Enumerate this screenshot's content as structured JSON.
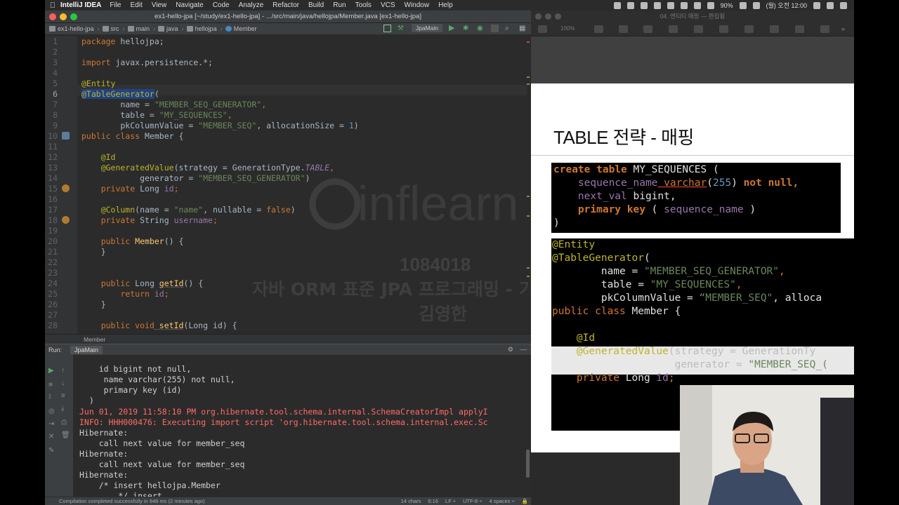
{
  "menubar": {
    "app_name": "IntelliJ IDEA",
    "items": [
      "File",
      "Edit",
      "View",
      "Navigate",
      "Code",
      "Analyze",
      "Refactor",
      "Build",
      "Run",
      "Tools",
      "VCS",
      "Window",
      "Help"
    ],
    "battery": "90%",
    "clock": "(월) 오전 12:00"
  },
  "ide": {
    "window_title": "ex1-hello-jpa [~/study/ex1-hello-jpa] - .../src/main/java/hellojpa/Member.java [ex1-hello-jpa]",
    "breadcrumbs": [
      "ex1-hello-jpa",
      "src",
      "main",
      "java",
      "hellojpa",
      "Member"
    ],
    "run_config": "JpaMain",
    "line_numbers": [
      "1",
      "2",
      "3",
      "4",
      "5",
      "6",
      "7",
      "8",
      "9",
      "10",
      "11",
      "12",
      "13",
      "14",
      "15",
      "16",
      "17",
      "18",
      "19",
      "20",
      "21",
      "22",
      "23",
      "24",
      "25",
      "26",
      "27",
      "28"
    ],
    "code_lines": {
      "l1_kw": "package",
      "l1_rest": " hellojpa;",
      "l3_kw": "import",
      "l3_rest": " javax.persistence.*;",
      "l5": "@Entity",
      "l6_an": "@TableGenerator",
      "l6_rest": "(",
      "l7_a": "        name = ",
      "l7_s": "\"MEMBER_SEQ_GENERATOR\"",
      "l7_b": ",",
      "l8_a": "        table = ",
      "l8_s": "\"MY_SEQUENCES\"",
      "l8_b": ",",
      "l9_a": "        pkColumnValue = ",
      "l9_s": "\"MEMBER_SEQ\"",
      "l9_b": ", allocationSize = ",
      "l9_n": "1",
      "l9_c": ")",
      "l10_kw": "public class",
      "l10_rest": " Member {",
      "l12": "    @Id",
      "l13_an": "    @GeneratedValue",
      "l13_a": "(strategy = GenerationType.",
      "l13_it": "TABLE",
      "l13_b": ",",
      "l14_a": "            generator = ",
      "l14_s": "\"MEMBER_SEQ_GENERATOR\"",
      "l14_b": ")",
      "l15_kw": "    private",
      "l15_a": " Long ",
      "l15_f": "id",
      "l15_b": ";",
      "l17_an": "    @Column",
      "l17_a": "(name = ",
      "l17_s": "\"name\"",
      "l17_b": ", nullable = ",
      "l17_kw": "false",
      "l17_c": ")",
      "l18_kw": "    private",
      "l18_a": " String ",
      "l18_f": "username",
      "l18_b": ";",
      "l20_kw": "    public",
      "l20_fn": " Member",
      "l20_a": "() {",
      "l21": "    }",
      "l24_kw": "    public",
      "l24_a": " Long ",
      "l24_fn": "getId",
      "l24_b": "() {",
      "l25_kw": "        return",
      "l25_f": " id",
      "l25_b": ";",
      "l26": "    }",
      "l28_kw": "    public void",
      "l28_fn": " setId",
      "l28_a": "(Long id) {"
    },
    "file_tab": "Member",
    "watermark": {
      "brand": "inflearn",
      "id": "1084018",
      "course": "자바 ORM 표준 JPA 프로그래밍 - 기본편",
      "owner": "김영한"
    },
    "run_panel": {
      "label": "Run:",
      "tab": "JpaMain",
      "console_lines": [
        "    id bigint not null,",
        "     name varchar(255) not null,",
        "     primary key (id)",
        "  )",
        "Jun 01, 2019 11:58:10 PM org.hibernate.tool.schema.internal.SchemaCreatorImpl applyI",
        "INFO: HHH000476: Executing import script 'org.hibernate.tool.schema.internal.exec.Sc",
        "Hibernate:",
        "    call next value for member_seq",
        "Hibernate:",
        "    call next value for member_seq",
        "Hibernate:",
        "    /* insert hellojpa.Member",
        "        */ insert"
      ]
    },
    "status": {
      "message": "Compilation completed successfully in 948 ms (2 minutes ago)",
      "chars": "14 chars",
      "position": "6:16",
      "line_sep": "LF ÷",
      "encoding": "UTF-8 ÷",
      "indent": "4 spaces ÷"
    }
  },
  "keynote": {
    "window_title": "04. 엔티티 매핑 — 편집됨",
    "zoom": "100%",
    "slide": {
      "title": "TABLE 전략 - 매핑",
      "sql": {
        "l1_kw": "create table",
        "l1_rest": " MY_SEQUENCES (",
        "l2_fd": "    sequence_name",
        "l2_ty": " varchar",
        "l2_a": "(",
        "l2_n": "255",
        "l2_b": ") ",
        "l2_kw": "not null,",
        "l3_fd": "    next_val",
        "l3_a": " bigint,",
        "l4_kw": "    primary key",
        "l4_a": " ( ",
        "l4_fd": "sequence_name",
        "l4_b": " )",
        "l5": ")"
      },
      "java": {
        "l1": "@Entity",
        "l2_an": "@TableGenerator",
        "l2_rest": "(",
        "l3_a": "        name = ",
        "l3_s": "\"MEMBER_SEQ_GENERATOR\"",
        "l3_b": ",",
        "l4_a": "        table = ",
        "l4_s": "\"MY_SEQUENCES\"",
        "l4_b": ",",
        "l5_a": "        pkColumnValue = ",
        "l5_s": "“MEMBER_SEQ\"",
        "l5_b": ", alloca",
        "l6_kw": "public class",
        "l6_rest": " Member {",
        "l8": "    @Id",
        "l9_an": "    @GeneratedValue",
        "l9_a": "(strategy = GenerationTy",
        "l10_a": "                    generator = ",
        "l10_s": "\"MEMBER_SEQ_(",
        "l11_kw": "    private",
        "l11_a": " Long ",
        "l11_f": "id",
        "l11_b": ";"
      }
    }
  },
  "colors": {
    "ide_bg": "#2b2b2b",
    "keyword": "#cc7832",
    "annotation": "#bbb529",
    "string": "#6a8759",
    "number": "#6897bb",
    "console_error": "#ff6b68"
  }
}
